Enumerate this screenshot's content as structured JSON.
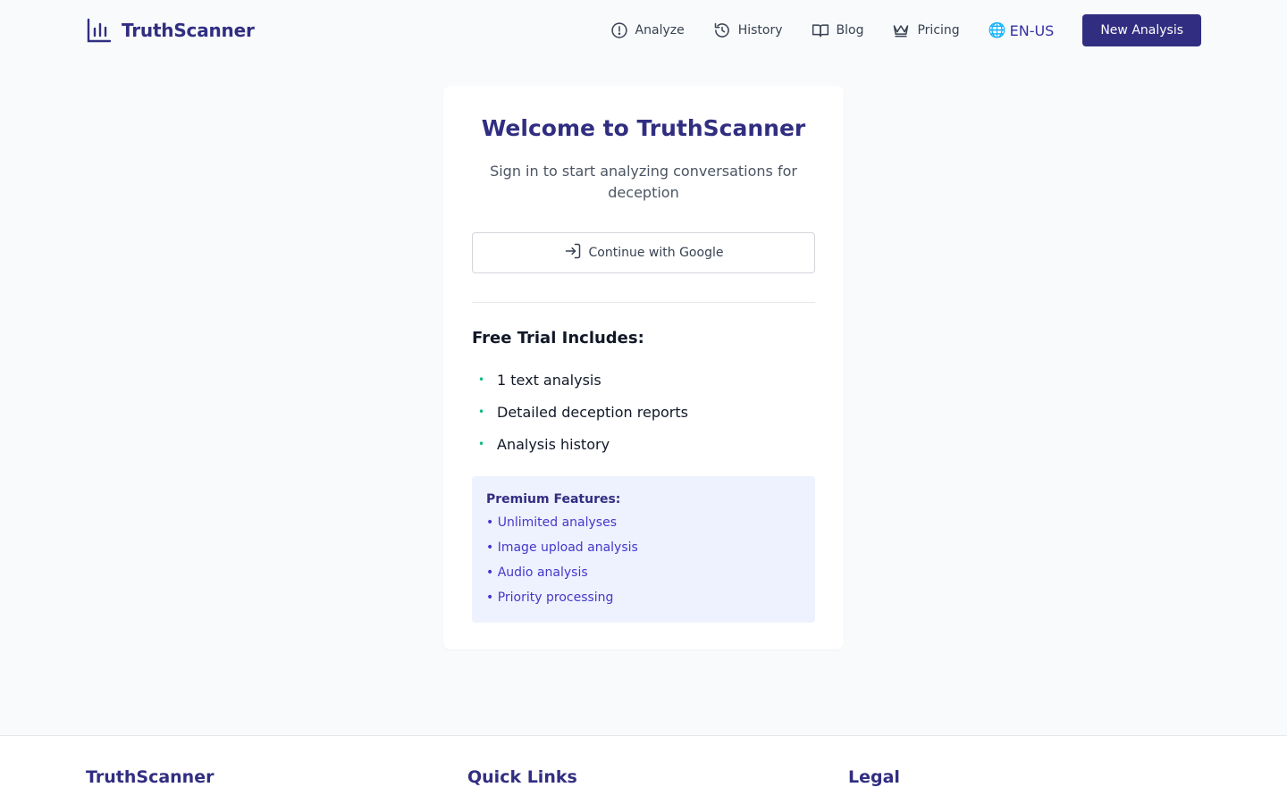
{
  "brand": {
    "name": "TruthScanner",
    "icon": "bar-chart-icon"
  },
  "nav": {
    "items": [
      {
        "label": "Analyze",
        "icon": "alert-circle-icon"
      },
      {
        "label": "History",
        "icon": "history-icon"
      },
      {
        "label": "Blog",
        "icon": "book-open-icon"
      },
      {
        "label": "Pricing",
        "icon": "crown-icon"
      }
    ],
    "language": "EN-US",
    "new_analysis": "New Analysis"
  },
  "card": {
    "title": "Welcome to TruthScanner",
    "subtitle": "Sign in to start analyzing conversations for deception",
    "google_button": "Continue with Google",
    "trial": {
      "title": "Free Trial Includes:",
      "items": [
        "1 text analysis",
        "Detailed deception reports",
        "Analysis history"
      ],
      "bullet": "•"
    },
    "premium": {
      "title": "Premium Features:",
      "items": [
        "• Unlimited analyses",
        "• Image upload analysis",
        "• Audio analysis",
        "• Priority processing"
      ]
    }
  },
  "footer": {
    "columns": [
      "TruthScanner",
      "Quick Links",
      "Legal"
    ]
  },
  "colors": {
    "brand": "#312e81",
    "accent": "#4338ca",
    "bullet": "#10b981",
    "premium_bg": "#eef2ff",
    "page_bg": "#f8fafc"
  }
}
